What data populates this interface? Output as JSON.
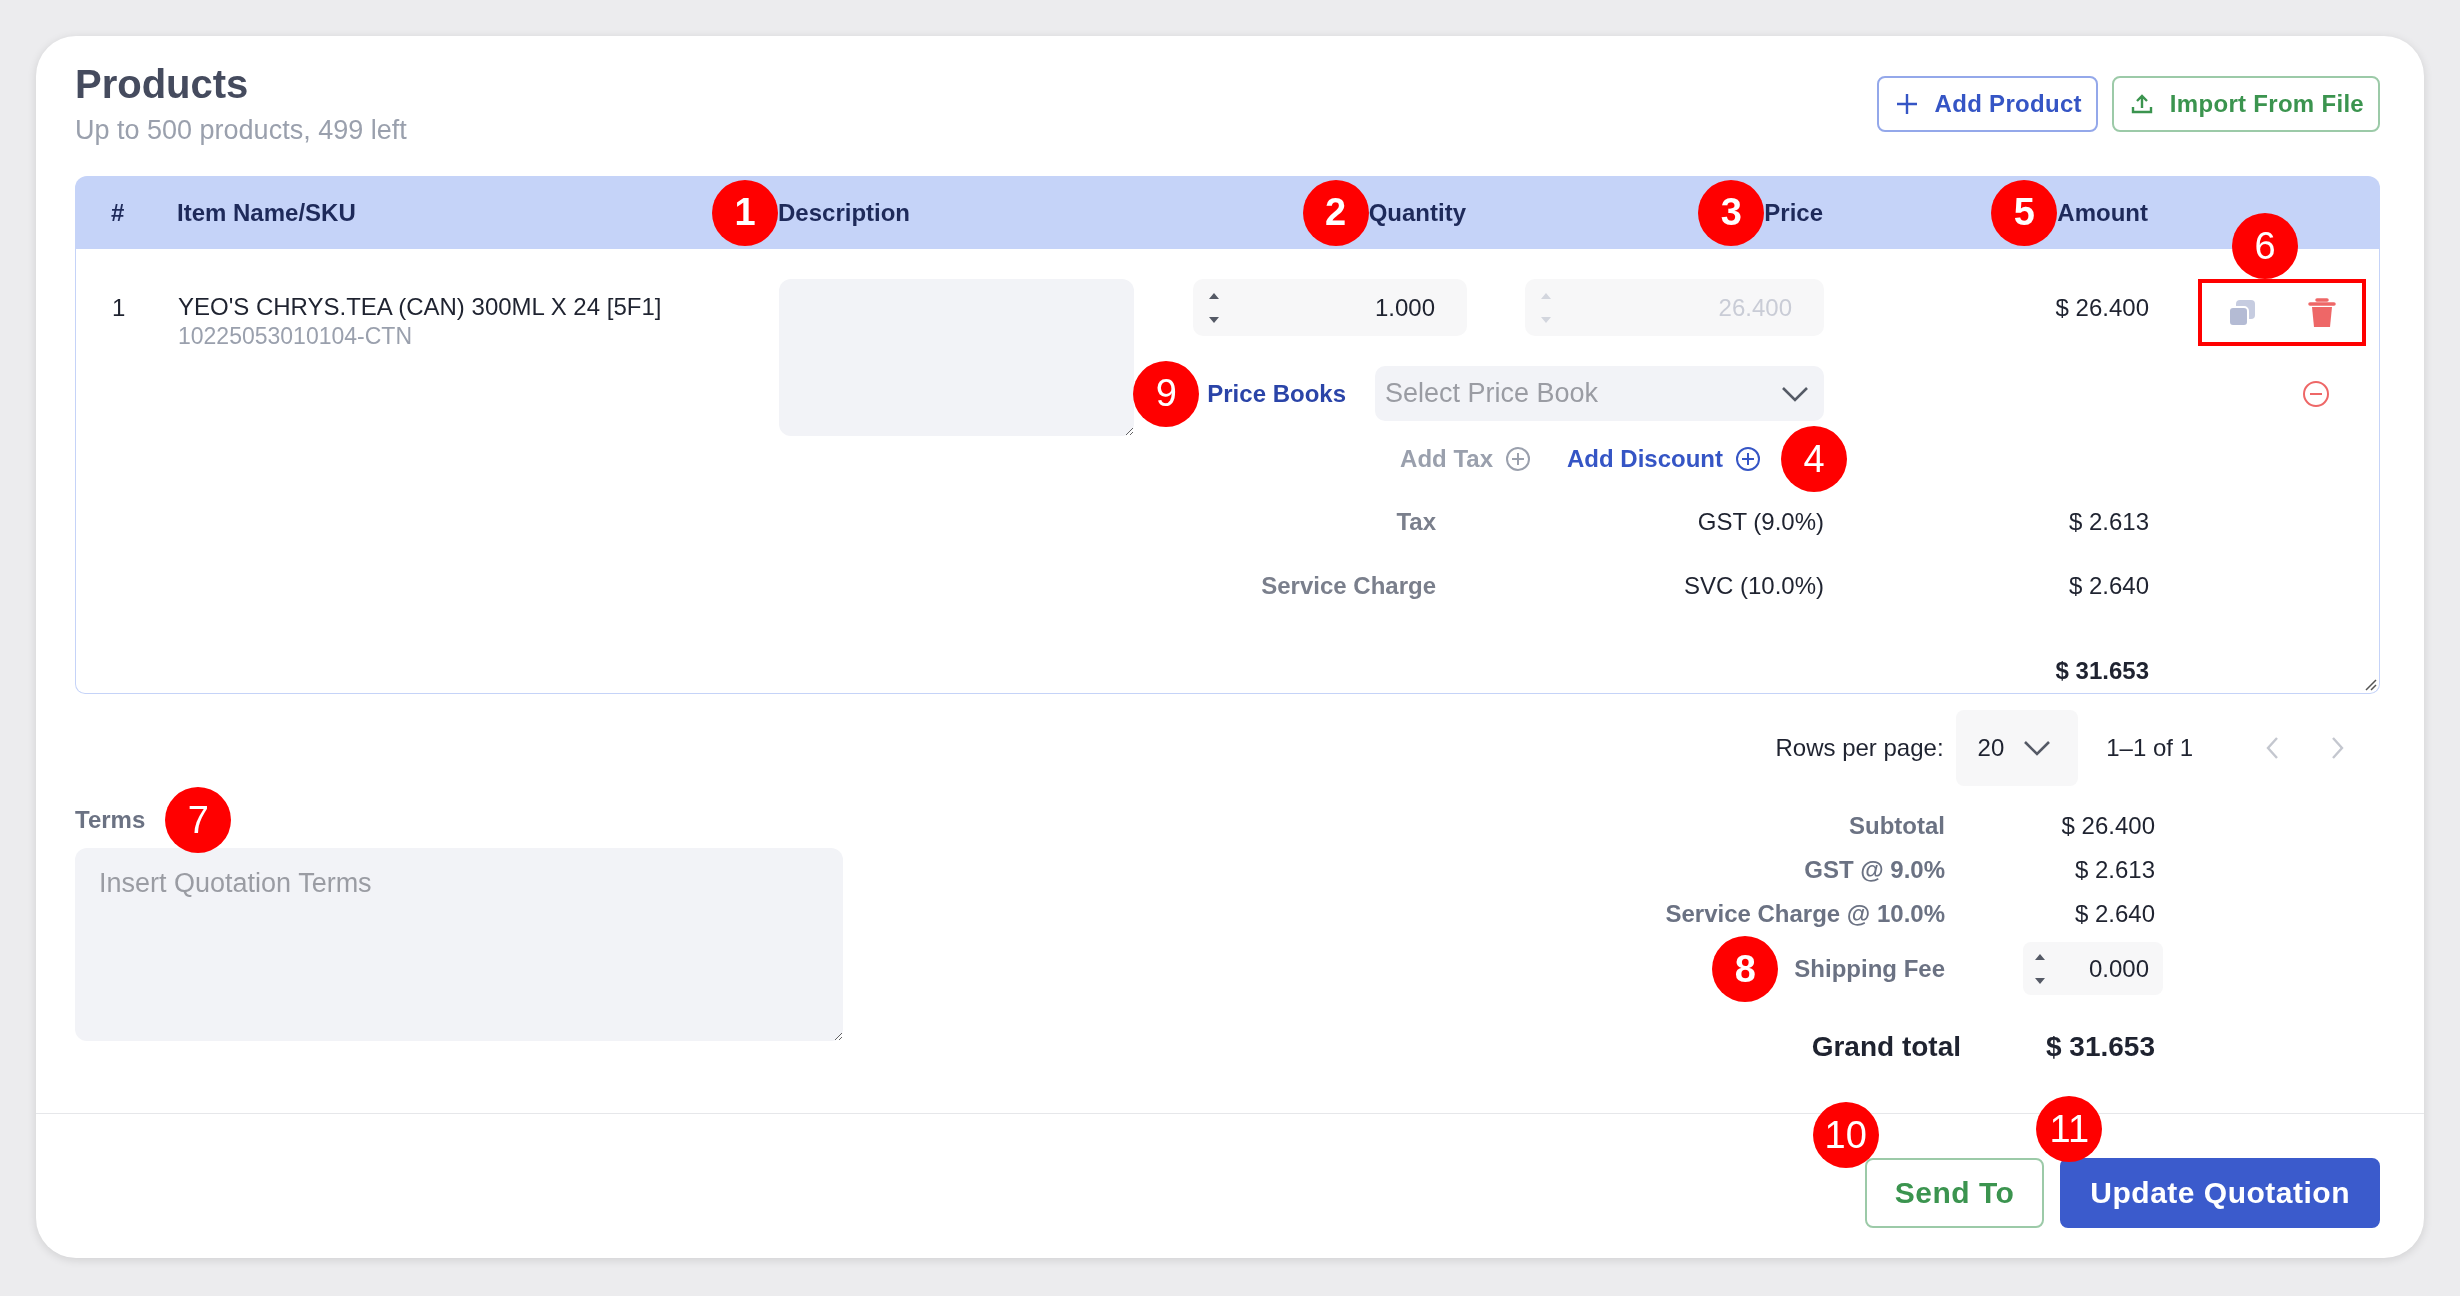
{
  "header": {
    "title": "Products",
    "subtitle": "Up to 500 products, 499 left",
    "buttons": [
      {
        "label": "Add Product",
        "kind": "add"
      },
      {
        "label": "Import From File",
        "kind": "import"
      }
    ]
  },
  "table": {
    "columns": [
      {
        "label": "#"
      },
      {
        "label": "Item Name/SKU"
      },
      {
        "label": "Description",
        "callout": "1"
      },
      {
        "label": "Quantity",
        "callout": "2"
      },
      {
        "label": "Price",
        "callout": "3"
      },
      {
        "label": "Amount",
        "callout": "5"
      }
    ],
    "rows": [
      {
        "index": "1",
        "name": "YEO'S CHRYS.TEA (CAN) 300ML X 24 [5F1]",
        "sku": "10225053010104-CTN",
        "quantity": "1.000",
        "price": "26.400",
        "price_disabled": true,
        "amount": "$ 26.400",
        "actions_highlighted": true,
        "actions_callout": "6",
        "price_book": {
          "label": "Price Books",
          "placeholder": "Select Price Book",
          "callout": "9"
        },
        "add_tax": {
          "label": "Add Tax",
          "disabled": true
        },
        "add_discount": {
          "label": "Add Discount",
          "disabled": false,
          "callout": "4"
        },
        "charges": [
          {
            "label": "Tax",
            "name": "GST (9.0%)",
            "amount": "$ 2.613"
          },
          {
            "label": "Service Charge",
            "name": "SVC (10.0%)",
            "amount": "$ 2.640"
          }
        ],
        "total": "$ 31.653"
      }
    ]
  },
  "pagination": {
    "label": "Rows per page:",
    "rows_per_page": "20",
    "range": "1–1 of 1",
    "prev_disabled": true,
    "next_disabled": true
  },
  "terms": {
    "label": "Terms",
    "placeholder": "Insert Quotation Terms",
    "callout": "7"
  },
  "summary": {
    "lines": [
      {
        "label": "Subtotal",
        "value": "$ 26.400"
      },
      {
        "label": "GST @ 9.0%",
        "value": "$ 2.613"
      },
      {
        "label": "Service Charge @ 10.0%",
        "value": "$ 2.640"
      }
    ],
    "shipping": {
      "label": "Shipping Fee",
      "value": "0.000",
      "callout": "8"
    },
    "grand_total": {
      "label": "Grand total",
      "value": "$ 31.653"
    }
  },
  "actions": [
    {
      "label": "Send To",
      "kind": "outline",
      "callout": "10"
    },
    {
      "label": "Update Quotation",
      "kind": "primary",
      "callout": "11"
    }
  ]
}
